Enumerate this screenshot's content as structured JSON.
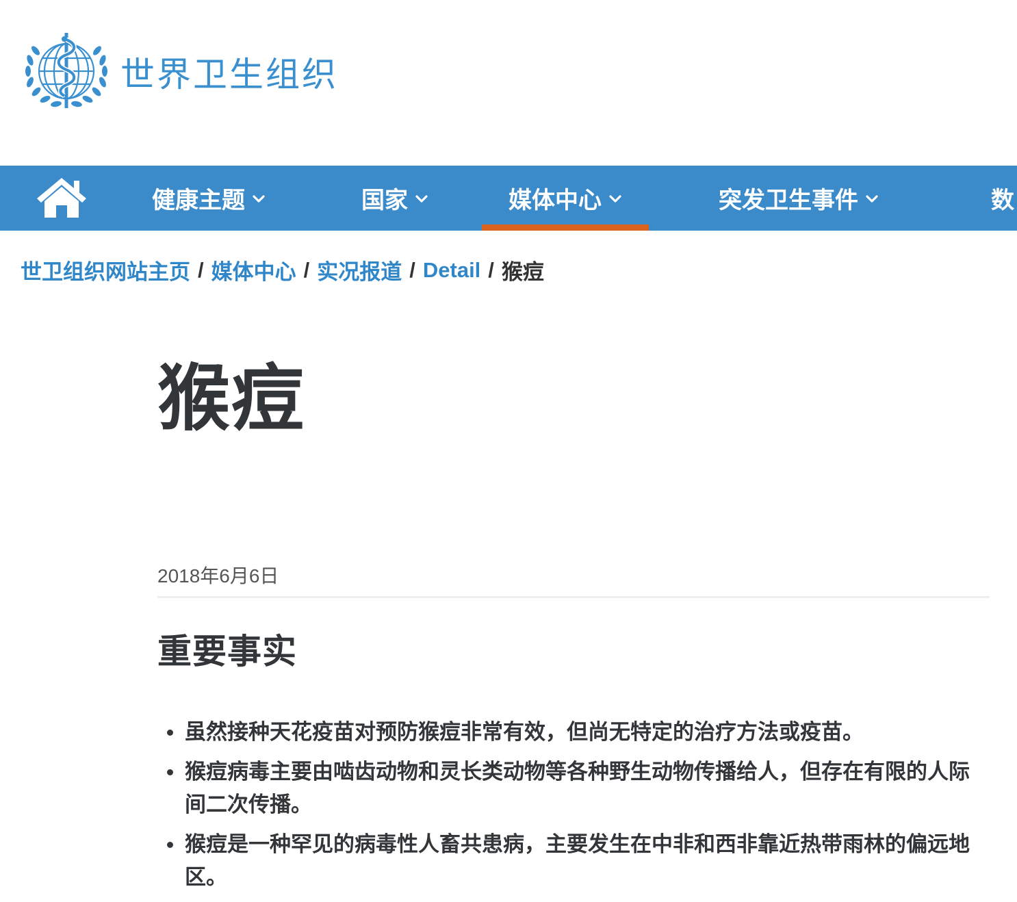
{
  "header": {
    "logo_text": "世界卫生组织",
    "logo_emblem_icon": "who-emblem-icon"
  },
  "colors": {
    "brand_blue": "#3b8bcb",
    "link_blue": "#2f86c9",
    "active_underline": "#d9621f",
    "text_dark": "#333639"
  },
  "nav": {
    "home_icon": "home-icon",
    "items": [
      {
        "label": "健康主题",
        "has_dropdown": true,
        "active": false
      },
      {
        "label": "国家",
        "has_dropdown": true,
        "active": false
      },
      {
        "label": "媒体中心",
        "has_dropdown": true,
        "active": true
      },
      {
        "label": "突发卫生事件",
        "has_dropdown": true,
        "active": false
      },
      {
        "label": "数",
        "has_dropdown": false,
        "active": false
      }
    ]
  },
  "breadcrumb": {
    "separator": "/",
    "items": [
      {
        "label": "世卫组织网站主页"
      },
      {
        "label": "媒体中心"
      },
      {
        "label": "实况报道"
      },
      {
        "label": "Detail"
      }
    ],
    "current": "猴痘"
  },
  "article": {
    "title": "猴痘",
    "date": "2018年6月6日",
    "section_heading": "重要事实",
    "facts": [
      "虽然接种天花疫苗对预防猴痘非常有效，但尚无特定的治疗方法或疫苗。",
      "猴痘病毒主要由啮齿动物和灵长类动物等各种野生动物传播给人，但存在有限的人际间二次传播。",
      "猴痘是一种罕见的病毒性人畜共患病，主要发生在中非和西非靠近热带雨林的偏远地区。"
    ]
  }
}
